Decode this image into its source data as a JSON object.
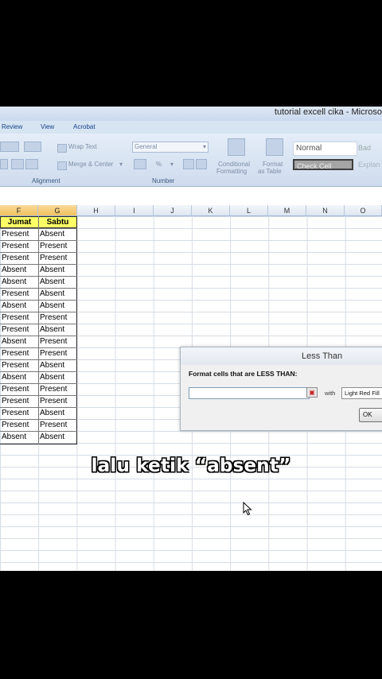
{
  "window": {
    "title": "tutorial excell cika - Microso"
  },
  "ribbon": {
    "tabs": [
      "Review",
      "View",
      "Acrobat"
    ],
    "wrap_text": "Wrap Text",
    "merge_center": "Merge & Center",
    "number_format": "General",
    "percent": "%",
    "conditional_formatting": [
      "Conditional",
      "Formatting"
    ],
    "format_as_table": [
      "Format",
      "as Table"
    ],
    "group_alignment": "Alignment",
    "group_number": "Number",
    "styles": {
      "normal": "Normal",
      "bad": "Bad",
      "check_cell": "Check Cell",
      "explanatory": "Explan"
    }
  },
  "columns": [
    "F",
    "G",
    "H",
    "I",
    "J",
    "K",
    "L",
    "M",
    "N",
    "O"
  ],
  "table": {
    "headers": [
      "Jumat",
      "Sabtu"
    ],
    "rows": [
      [
        "Present",
        "Absent"
      ],
      [
        "Present",
        "Present"
      ],
      [
        "Present",
        "Present"
      ],
      [
        "Absent",
        "Absent"
      ],
      [
        "Absent",
        "Absent"
      ],
      [
        "Present",
        "Absent"
      ],
      [
        "Absent",
        "Absent"
      ],
      [
        "Present",
        "Present"
      ],
      [
        "Present",
        "Absent"
      ],
      [
        "Absent",
        "Present"
      ],
      [
        "Present",
        "Present"
      ],
      [
        "Present",
        "Absent"
      ],
      [
        "Absent",
        "Absent"
      ],
      [
        "Present",
        "Present"
      ],
      [
        "Present",
        "Present"
      ],
      [
        "Present",
        "Absent"
      ],
      [
        "Present",
        "Present"
      ],
      [
        "Absent",
        "Absent"
      ]
    ]
  },
  "dialog": {
    "title": "Less Than",
    "prompt": "Format cells that are LESS THAN:",
    "input_value": "",
    "with_label": "with",
    "format_option": "Light Red Fill",
    "ok_label": "OK"
  },
  "caption": "lalu ketik “absent”",
  "colors": {
    "header_fill": "#ffff66",
    "ribbon_bg": "#dbe6f4",
    "selected_col": "#f6c96a"
  }
}
